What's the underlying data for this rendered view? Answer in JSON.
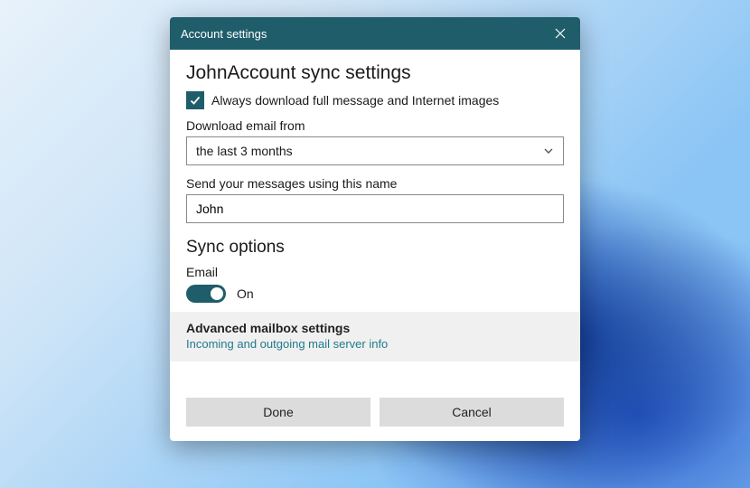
{
  "titlebar": {
    "title": "Account settings"
  },
  "main": {
    "heading": "JohnAccount sync settings",
    "always_download_label": "Always download full message and Internet images",
    "always_download_checked": true,
    "download_from_label": "Download email from",
    "download_from_value": "the last 3 months",
    "display_name_label": "Send your messages using this name",
    "display_name_value": "John"
  },
  "sync": {
    "heading": "Sync options",
    "email_label": "Email",
    "email_on": true,
    "email_state_text": "On"
  },
  "advanced": {
    "title": "Advanced mailbox settings",
    "subtitle": "Incoming and outgoing mail server info"
  },
  "buttons": {
    "done": "Done",
    "cancel": "Cancel"
  }
}
